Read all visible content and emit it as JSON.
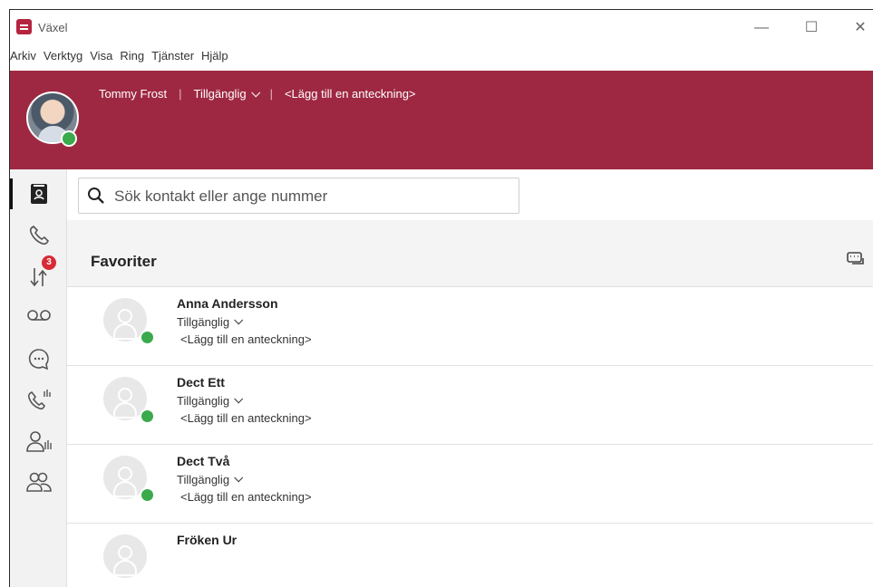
{
  "window": {
    "title": "Växel",
    "controls": {
      "minimize": "—",
      "maximize": "☐",
      "close": "✕"
    }
  },
  "menu": [
    "Arkiv",
    "Verktyg",
    "Visa",
    "Ring",
    "Tjänster",
    "Hjälp"
  ],
  "header": {
    "user_name": "Tommy Frost",
    "status": "Tillgänglig",
    "note_prompt": "<Lägg till en anteckning>",
    "separator": "|"
  },
  "nav": {
    "badge_count": "3",
    "items": [
      {
        "icon": "contacts-icon",
        "active": true
      },
      {
        "icon": "phone-icon"
      },
      {
        "icon": "transfer-icon"
      },
      {
        "icon": "voicemail-icon"
      },
      {
        "icon": "chat-icon"
      },
      {
        "icon": "call-stats-icon"
      },
      {
        "icon": "user-stats-icon"
      },
      {
        "icon": "group-icon"
      }
    ]
  },
  "search": {
    "placeholder": "Sök kontakt eller ange nummer"
  },
  "favorites": {
    "title": "Favoriter"
  },
  "contacts": [
    {
      "name": "Anna Andersson",
      "status": "Tillgänglig",
      "note": "<Lägg till en anteckning>"
    },
    {
      "name": "Dect Ett",
      "status": "Tillgänglig",
      "note": "<Lägg till en anteckning>"
    },
    {
      "name": "Dect Två",
      "status": "Tillgänglig",
      "note": "<Lägg till en anteckning>"
    },
    {
      "name": "Fröken Ur",
      "status": "",
      "note": ""
    }
  ],
  "colors": {
    "brand": "#9e2842",
    "online": "#3aaa4c",
    "badge": "#d72b35"
  }
}
